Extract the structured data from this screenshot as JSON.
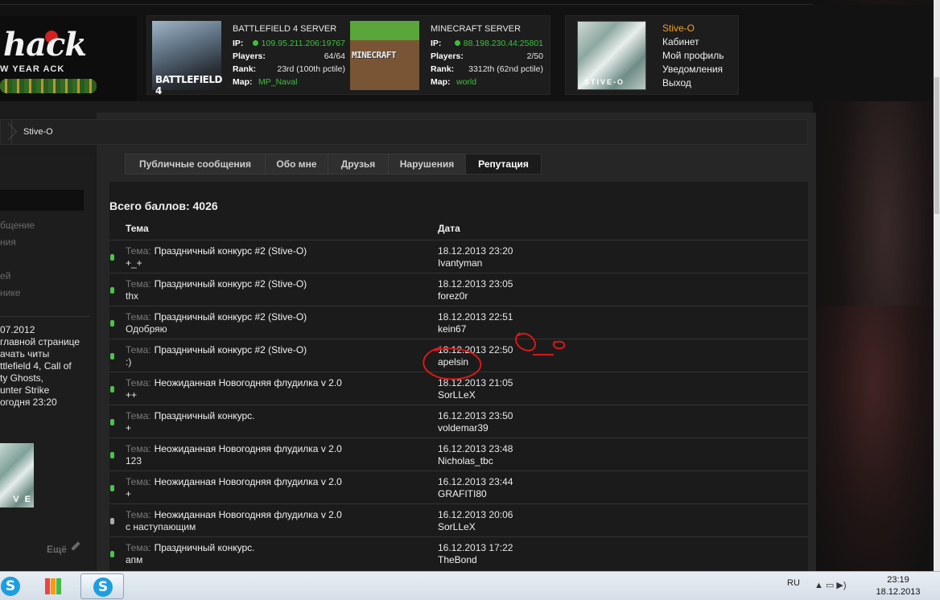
{
  "header": {
    "logo_text": "hack",
    "logo_sub": "W YEAR  ACK",
    "servers": [
      {
        "name": "BATTLEFIELD 4 SERVER",
        "thumb_text": "BATTLEFIELD 4",
        "ip_label": "IP:",
        "ip": "109.95.211.206:19767",
        "players_label": "Players:",
        "players": "64/64",
        "rank_label": "Rank:",
        "rank": "23rd (100th pctile)",
        "map_label": "Map:",
        "map": "MP_Naval"
      },
      {
        "name": "MINECRAFT SERVER",
        "thumb_text": "MINECRAFT",
        "ip_label": "IP:",
        "ip": "88.198.230.44:25801",
        "players_label": "Players:",
        "players": "2/50",
        "rank_label": "Rank:",
        "rank": "3312th (62nd pctile)",
        "map_label": "Map:",
        "map": "world"
      }
    ],
    "user": {
      "avatar_text": "STIVE-O",
      "name": "Stive-O",
      "links": [
        "Кабинет",
        "Мой профиль",
        "Уведомления",
        "Выход"
      ]
    }
  },
  "breadcrumb": {
    "current": "Stive-O"
  },
  "sidebar": {
    "menu": [
      "бщение",
      "ния",
      "",
      "ей",
      "нике"
    ],
    "info": [
      "07.2012",
      "главной странице",
      "ачать читы",
      "ttlefield 4, Call of",
      "ty Ghosts,",
      "unter Strike",
      "огодня 23:20"
    ],
    "avatar_text": "V E",
    "more": "Ещё"
  },
  "tabs": [
    {
      "label": "Публичные сообщения",
      "active": false
    },
    {
      "label": "Обо мне",
      "active": false
    },
    {
      "label": "Друзья",
      "active": false
    },
    {
      "label": "Нарушения",
      "active": false
    },
    {
      "label": "Репутация",
      "active": true
    }
  ],
  "reputation": {
    "total": "Всего баллов: 4026",
    "col_topic": "Тема",
    "col_date": "Дата",
    "topic_prefix": "Тема:",
    "rows": [
      {
        "topic": "Праздничный конкурс #2 (Stive-O)",
        "comment": "+_+",
        "date": "18.12.2013 23:20",
        "user": "Ivantyman",
        "color": "green"
      },
      {
        "topic": "Праздничный конкурс #2 (Stive-O)",
        "comment": "thx",
        "date": "18.12.2013 23:05",
        "user": "forez0r",
        "color": "green"
      },
      {
        "topic": "Праздничный конкурс #2 (Stive-O)",
        "comment": "Одобряю",
        "date": "18.12.2013 22:51",
        "user": "kein67",
        "color": "green"
      },
      {
        "topic": "Праздничный конкурс #2 (Stive-O)",
        "comment": ":)",
        "date": "18.12.2013 22:50",
        "user": "apelsin",
        "color": "green"
      },
      {
        "topic": "Неожиданная Новогодняя флудилка v 2.0",
        "comment": "++",
        "date": "18.12.2013 21:05",
        "user": "SorLLeX",
        "color": "green"
      },
      {
        "topic": "Праздничный конкурс.",
        "comment": "+",
        "date": "16.12.2013 23:50",
        "user": "voldemar39",
        "color": "green"
      },
      {
        "topic": "Неожиданная Новогодняя флудилка v 2.0",
        "comment": "123",
        "date": "16.12.2013 23:48",
        "user": "Nicholas_tbc",
        "color": "green"
      },
      {
        "topic": "Неожиданная Новогодняя флудилка v 2.0",
        "comment": "+",
        "date": "16.12.2013 23:44",
        "user": "GRAFITI80",
        "color": "green"
      },
      {
        "topic": "Неожиданная Новогодняя флудилка v 2.0",
        "comment": "с наступающим",
        "date": "16.12.2013 20:06",
        "user": "SorLLeX",
        "color": "gray"
      },
      {
        "topic": "Праздничный конкурс.",
        "comment": "апм",
        "date": "16.12.2013 17:22",
        "user": "TheBond",
        "color": "green"
      }
    ]
  },
  "taskbar": {
    "lang": "RU",
    "time": "23:19",
    "date": "18.12.2013"
  },
  "colors": {
    "accent_user": "#f0a020",
    "status_green": "#3bc23b",
    "annotation_red": "#d81818"
  }
}
